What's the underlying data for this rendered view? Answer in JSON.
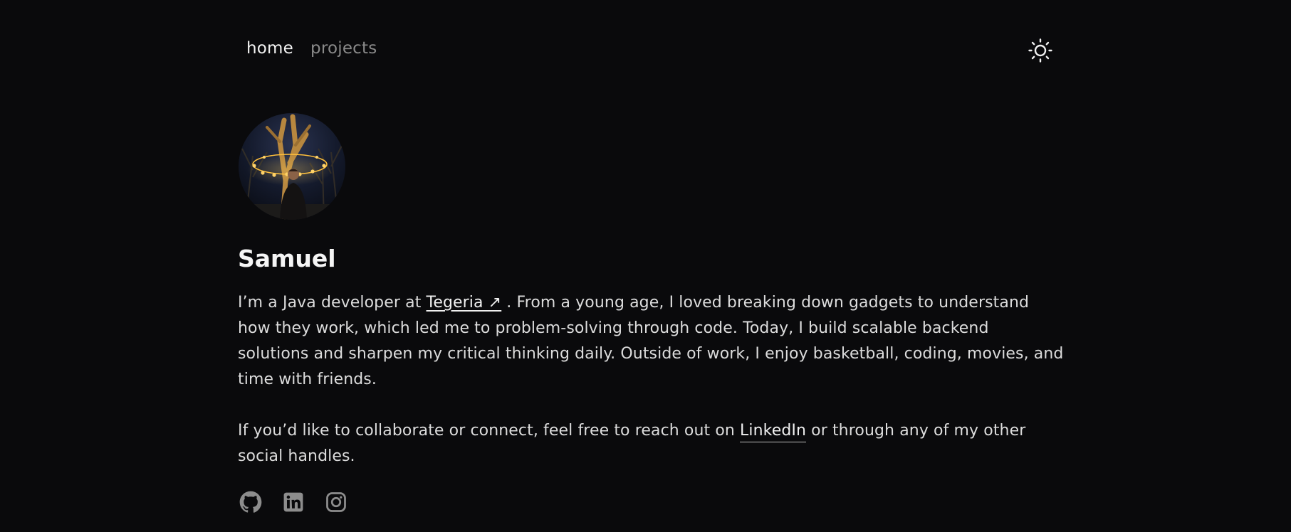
{
  "nav": {
    "items": [
      {
        "label": "home",
        "active": true
      },
      {
        "label": "projects",
        "active": false
      }
    ]
  },
  "theme_toggle": {
    "icon": "sun-icon"
  },
  "profile": {
    "name": "Samuel",
    "avatar_icon": "profile-photo"
  },
  "bio": {
    "p1_before": "I’m a Java developer at ",
    "p1_link": "Tegeria ↗",
    "p1_after": " . From a young age, I loved breaking down gadgets to understand how they work, which led me to problem-solving through code. Today, I build scalable backend solutions and sharpen my critical thinking daily. Outside of work, I enjoy basketball, coding, movies, and time with friends.",
    "p2_before": "If you’d like to collaborate or connect, feel free to reach out on ",
    "p2_link": "LinkedIn",
    "p2_after": " or through any of my other social handles."
  },
  "socials": [
    {
      "name": "github",
      "icon": "github-icon"
    },
    {
      "name": "linkedin",
      "icon": "linkedin-icon"
    },
    {
      "name": "instagram",
      "icon": "instagram-icon"
    }
  ],
  "colors": {
    "background": "#0a0a0c",
    "text": "#dcdcdc",
    "muted": "#8a8a8a",
    "icon": "#8d8d8d"
  }
}
